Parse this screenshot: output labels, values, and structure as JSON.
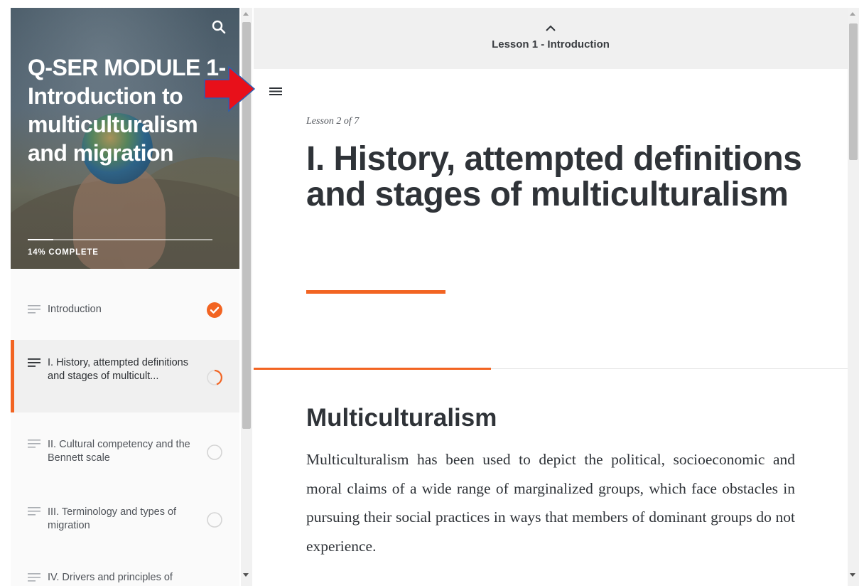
{
  "sidebar": {
    "course_title": "Q-SER MODULE 1- Introduction to multiculturalism and migration",
    "progress_label": "14% COMPLETE",
    "progress_value": 0.14,
    "search_icon": "search-icon",
    "lessons": [
      {
        "label": "Introduction",
        "status": "complete"
      },
      {
        "label": "I. History, attempted definitions and stages of multicult...",
        "status": "in-progress"
      },
      {
        "label": "II. Cultural competency and the Bennett scale",
        "status": "not-started"
      },
      {
        "label": "III. Terminology and types of migration",
        "status": "not-started"
      },
      {
        "label": "IV. Drivers and principles of",
        "status": "not-started"
      }
    ]
  },
  "main": {
    "previous_lesson_label": "Lesson 1 - Introduction",
    "lesson_count": "Lesson 2 of 7",
    "lesson_title": "I. History, attempted definitions and stages of multiculturalism",
    "section_heading": "Multiculturalism",
    "section_body": "Multiculturalism has been used to depict the political, socioeconomic and moral claims of a wide range of marginalized groups, which face obstacles in pursuing their social practices in ways that members of dominant groups do not experience."
  },
  "colors": {
    "accent": "#f26422",
    "annotation_arrow": "#e8101a",
    "annotation_arrow_outline": "#2e5fb0"
  }
}
